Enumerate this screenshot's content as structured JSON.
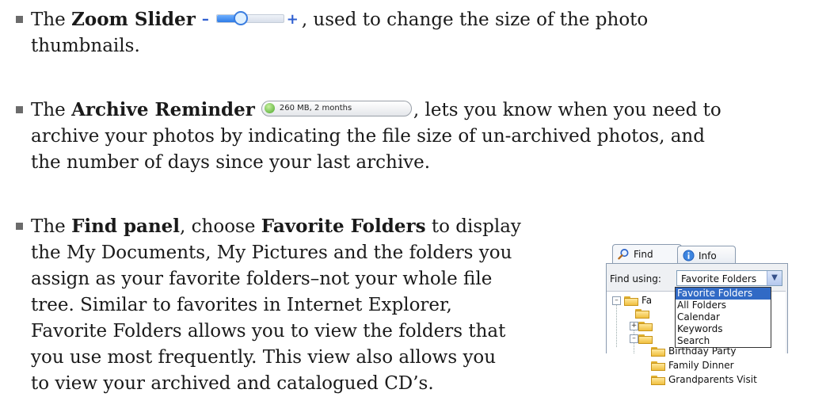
{
  "bullets": [
    {
      "lines": [
        [
          {
            "t": "The "
          },
          {
            "b": "Zoom Slider"
          },
          {
            "zoom": true
          },
          {
            "t": ", used to change the size of the photo"
          }
        ],
        [
          {
            "t": "thumbnails."
          }
        ]
      ]
    },
    {
      "lines": [
        [
          {
            "t": "The "
          },
          {
            "b": "Archive Reminder"
          },
          {
            "archive": true
          },
          {
            "t": ", lets you know when you need to"
          }
        ],
        [
          {
            "t": "archive your photos by indicating the file size of un-archived photos, and"
          }
        ],
        [
          {
            "t": "the number of days since your last archive."
          }
        ]
      ]
    },
    {
      "lines": [
        [
          {
            "t": "The "
          },
          {
            "b": "Find panel"
          },
          {
            "t": ", choose "
          },
          {
            "b": "Favorite Folders"
          },
          {
            "t": " to display"
          }
        ],
        [
          {
            "t": "the My Documents, My Pictures and the folders you"
          }
        ],
        [
          {
            "t": "assign as your favorite folders–not your whole file"
          }
        ],
        [
          {
            "t": "tree. Similar to favorites in Internet Explorer,"
          }
        ],
        [
          {
            "t": "Favorite Folders allows you to view the folders that"
          }
        ],
        [
          {
            "t": "you use most frequently. This view also allows you"
          }
        ],
        [
          {
            "t": "to view your archived and catalogued CD’s."
          }
        ]
      ]
    }
  ],
  "zoom_slider": {
    "minus": "–",
    "plus": "+",
    "level": 0.35,
    "accent": "#2d7be6"
  },
  "archive_reminder": {
    "text": "260 MB, 2 months",
    "status_color": "#4aa82a"
  },
  "find_panel": {
    "tabs": [
      {
        "label": "Find",
        "icon": "search-icon"
      },
      {
        "label": "Info",
        "icon": "info-icon"
      }
    ],
    "find_using_label": "Find using:",
    "select_value": "Favorite Folders",
    "dropdown_options": [
      "Favorite Folders",
      "All Folders",
      "Calendar",
      "Keywords",
      "Search"
    ],
    "selected_option": "Favorite Folders",
    "tree_root_partial": "Fa",
    "tree_items": [
      "Birthday Party",
      "Family Dinner",
      "Grandparents Visit"
    ],
    "highlight_color": "#316ac5"
  }
}
